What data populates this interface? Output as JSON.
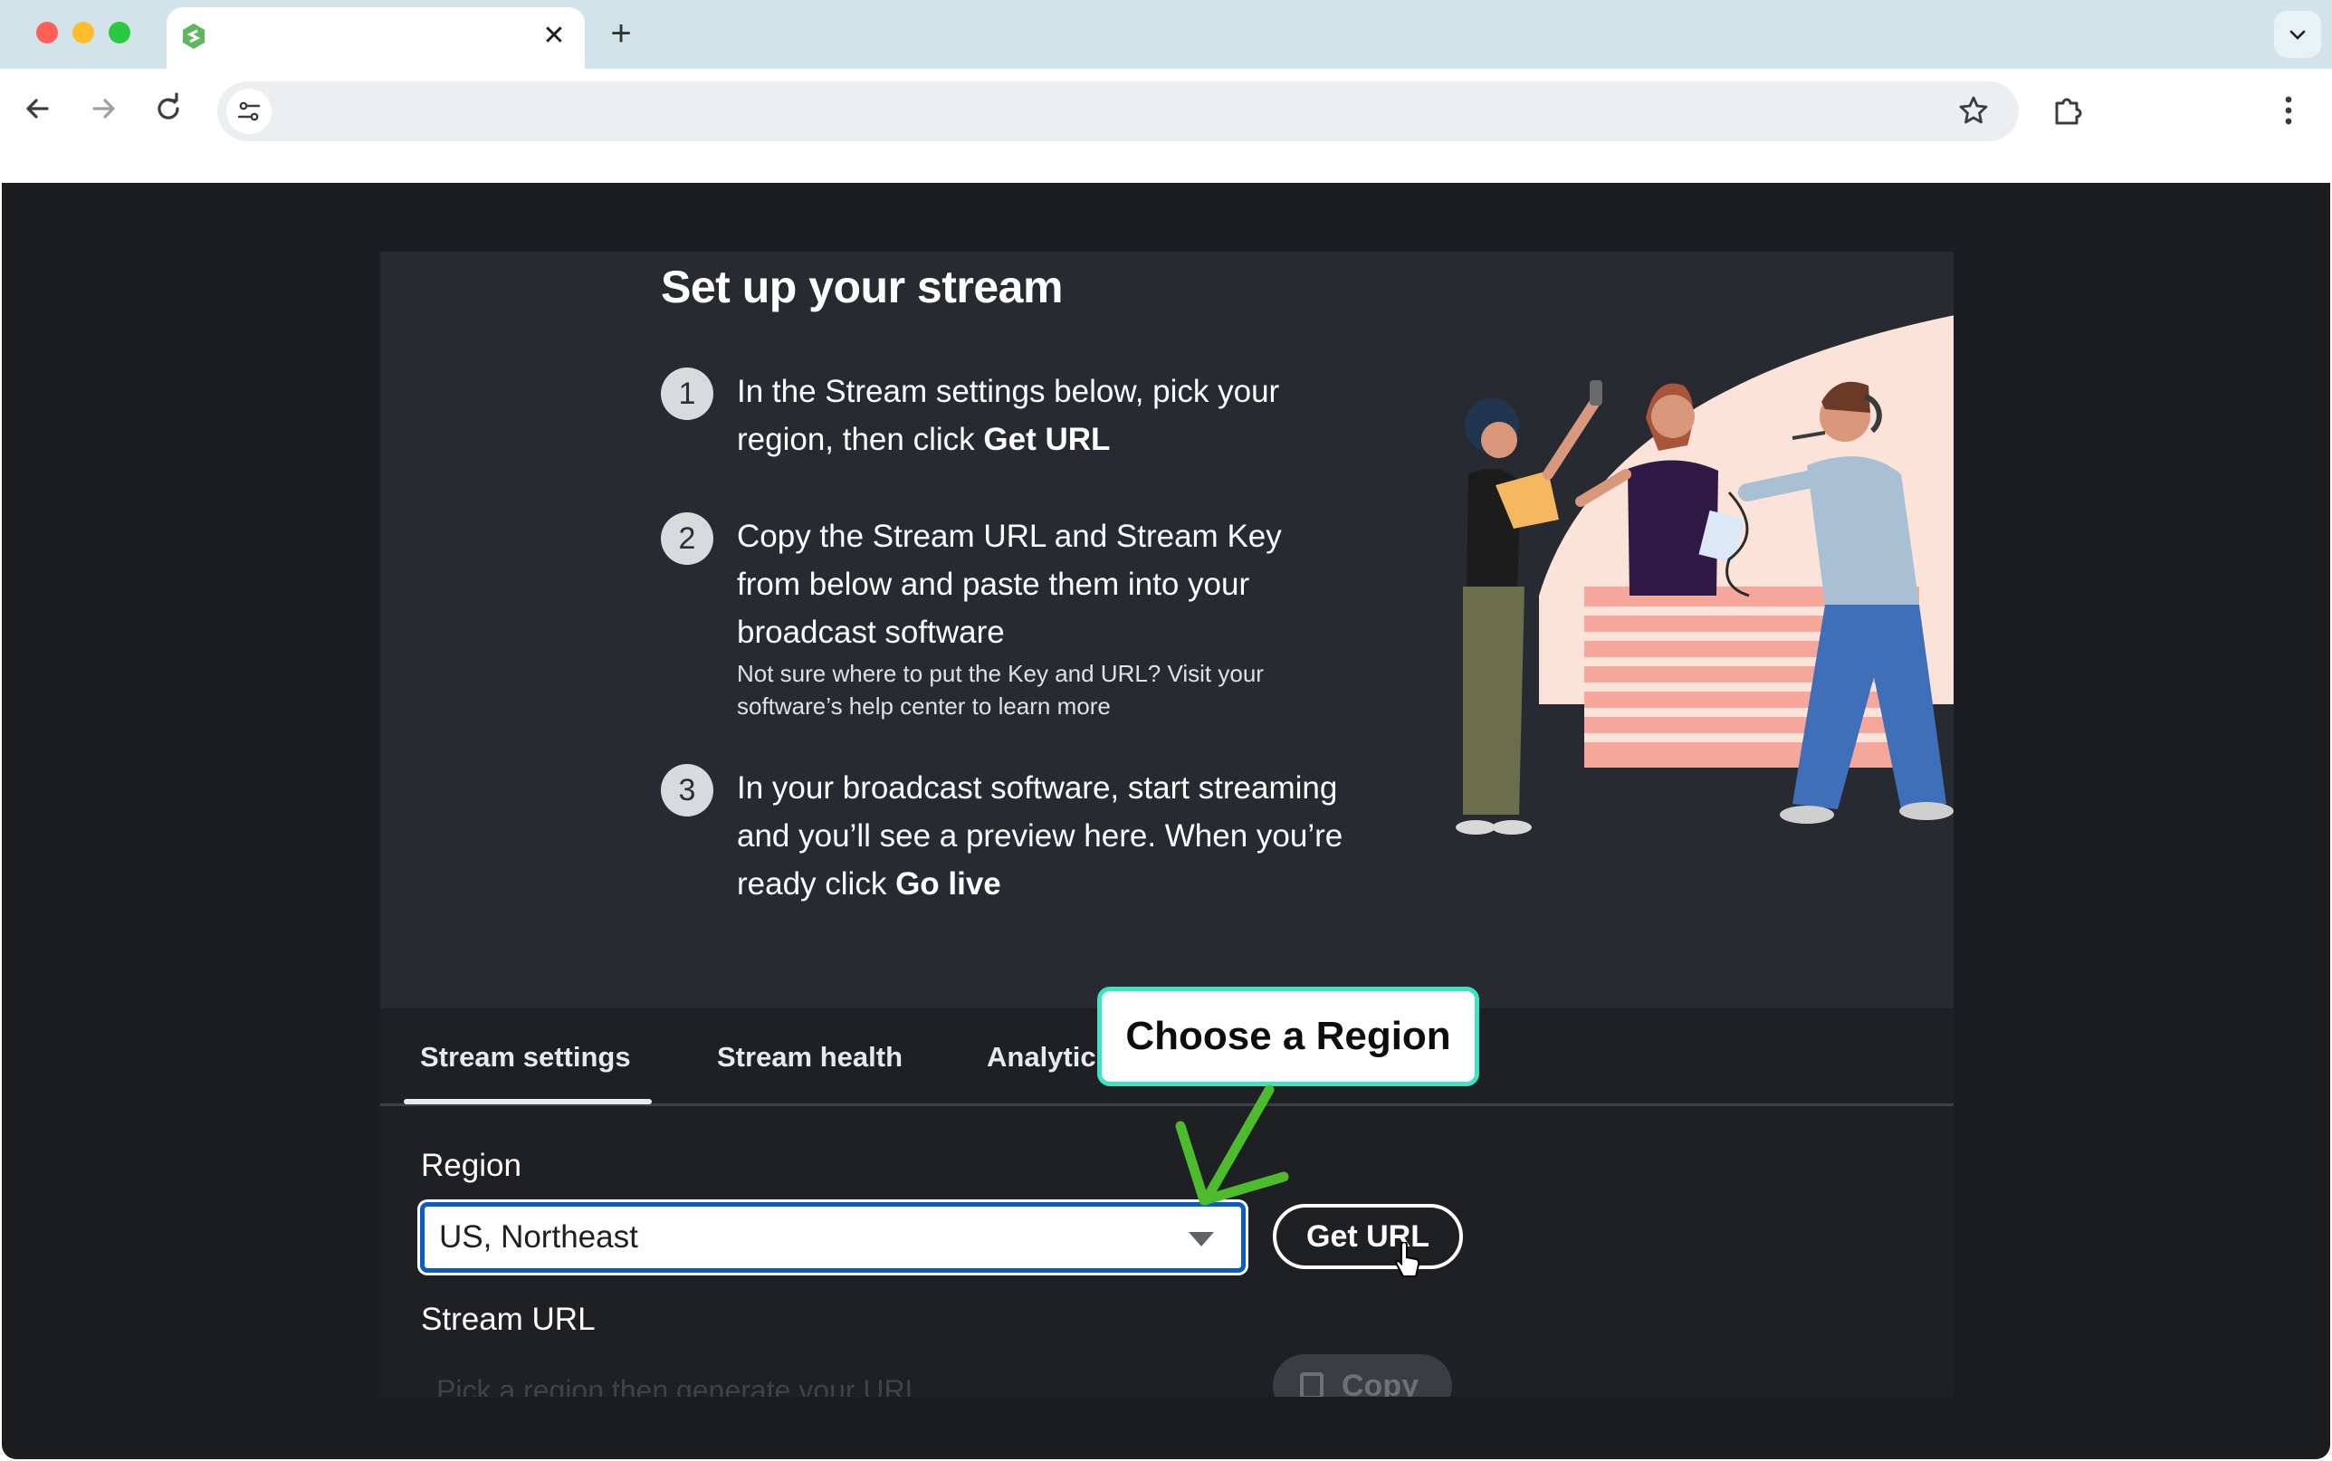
{
  "browser": {
    "tab": {
      "title": "",
      "close_glyph": "✕",
      "favicon": "green-hexagon-logo-icon"
    },
    "new_tab_glyph": "+",
    "address_bar": {
      "url": ""
    }
  },
  "hero": {
    "title": "Set up your stream",
    "steps": [
      {
        "number": "1",
        "text_a": "In the Stream settings below, pick your region, then click ",
        "bold": "Get URL",
        "note": ""
      },
      {
        "number": "2",
        "text_a": "Copy the Stream URL and Stream Key from below and paste them into your broadcast software",
        "bold": "",
        "note": "Not sure where to put the Key and URL? Visit your software’s help center to learn more"
      },
      {
        "number": "3",
        "text_a": "In your broadcast software, start streaming and you’ll see a preview here. When you’re ready click ",
        "bold": "Go live",
        "note": ""
      }
    ]
  },
  "tabs": {
    "settings": "Stream settings",
    "health": "Stream health",
    "analytics": "Analytics"
  },
  "form": {
    "region_label": "Region",
    "region_value": "US, Northeast",
    "get_url_label": "Get URL",
    "stream_url_label": "Stream URL",
    "stream_url_placeholder": "Pick a region then generate your URL",
    "copy_label": "Copy"
  },
  "annotation": {
    "callout_text": "Choose a Region",
    "callout_border_color": "#3ee3c4",
    "arrow_color": "#4cbb2c"
  }
}
